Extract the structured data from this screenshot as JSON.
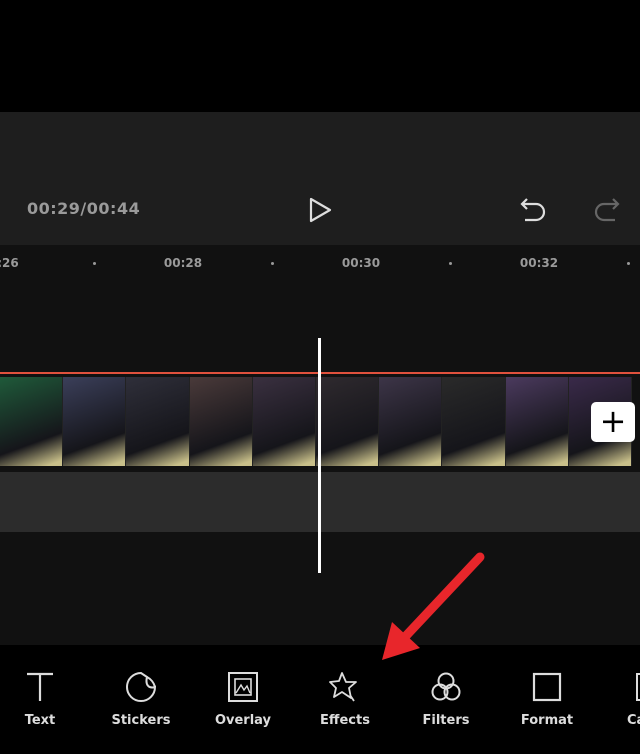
{
  "player": {
    "time": "00:29/00:44"
  },
  "ruler": {
    "ticks": [
      ":26",
      "00:28",
      "00:30",
      "00:32"
    ]
  },
  "timeline": {
    "add_label": "+",
    "frame_colors": [
      "#1f5a3a",
      "#3b3f5a",
      "#2f2f3a",
      "#4a3a3a",
      "#3a3040",
      "#2f2a2f",
      "#3d3548",
      "#2a2a2a",
      "#4b3a5e",
      "#3a2a4a"
    ]
  },
  "toolbar": {
    "items": [
      {
        "label": "Text",
        "icon": "text-icon"
      },
      {
        "label": "Stickers",
        "icon": "sticker-icon"
      },
      {
        "label": "Overlay",
        "icon": "overlay-icon"
      },
      {
        "label": "Effects",
        "icon": "effects-star-icon"
      },
      {
        "label": "Filters",
        "icon": "filters-icon"
      },
      {
        "label": "Format",
        "icon": "format-square-icon"
      },
      {
        "label": "Ca",
        "icon": "canvas-icon"
      }
    ]
  },
  "annotation_color": "#e8262b"
}
